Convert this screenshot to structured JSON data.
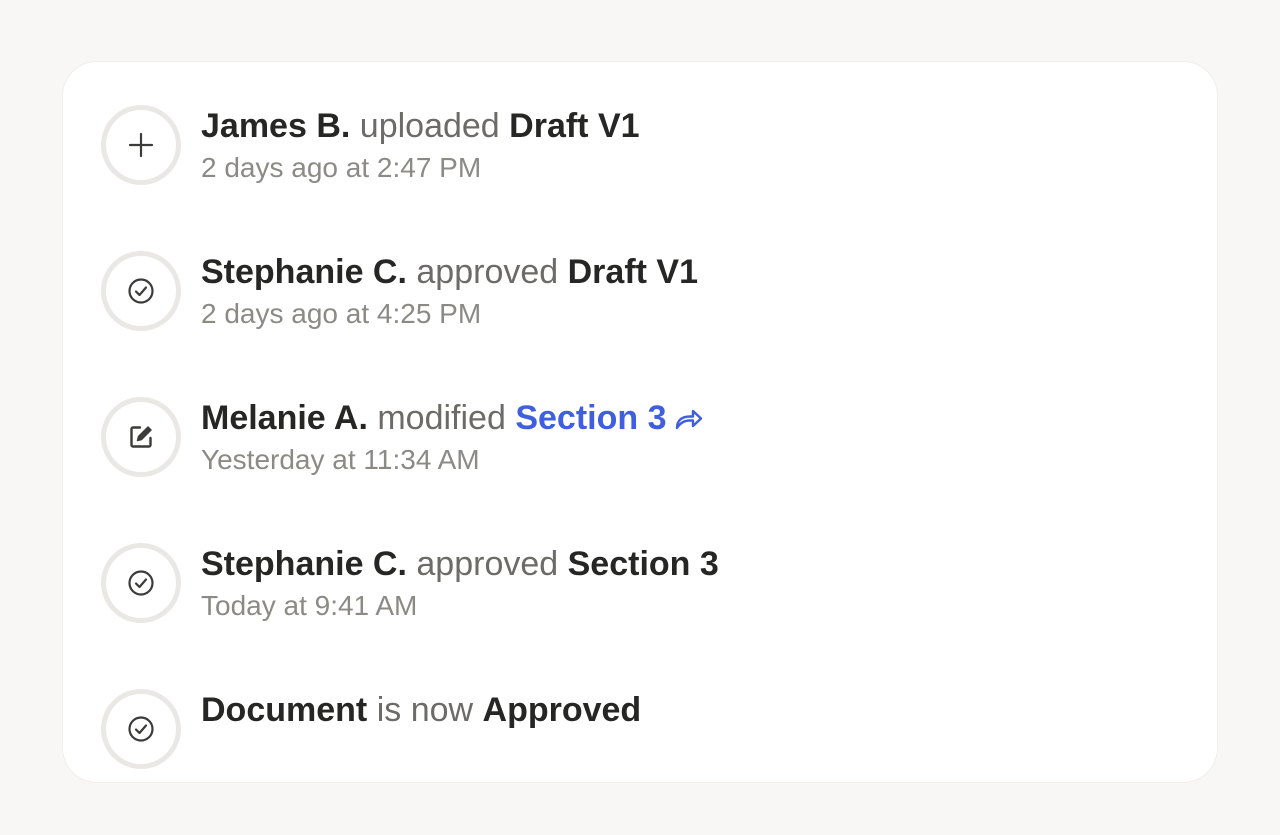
{
  "activity": [
    {
      "icon": "plus-icon",
      "actor": "James B.",
      "verb": "uploaded",
      "target": "Draft V1",
      "target_is_link": false,
      "time": "2 days ago at 2:47 PM"
    },
    {
      "icon": "check-circle-icon",
      "actor": "Stephanie C.",
      "verb": "approved",
      "target": "Draft V1",
      "target_is_link": false,
      "time": "2 days ago at 4:25 PM"
    },
    {
      "icon": "edit-icon",
      "actor": "Melanie A.",
      "verb": "modified",
      "target": "Section 3",
      "target_is_link": true,
      "time": "Yesterday at 11:34 AM"
    },
    {
      "icon": "check-circle-icon",
      "actor": "Stephanie C.",
      "verb": "approved",
      "target": "Section 3",
      "target_is_link": false,
      "time": "Today at 9:41 AM"
    },
    {
      "icon": "check-circle-icon",
      "actor": "Document",
      "verb": "is now",
      "target": "Approved",
      "target_is_link": false,
      "time": ""
    }
  ],
  "colors": {
    "background": "#f8f7f5",
    "card": "#ffffff",
    "link": "#3f5fe0",
    "muted": "#8b8a84",
    "verb": "#6c6b67",
    "strong": "#262625"
  }
}
